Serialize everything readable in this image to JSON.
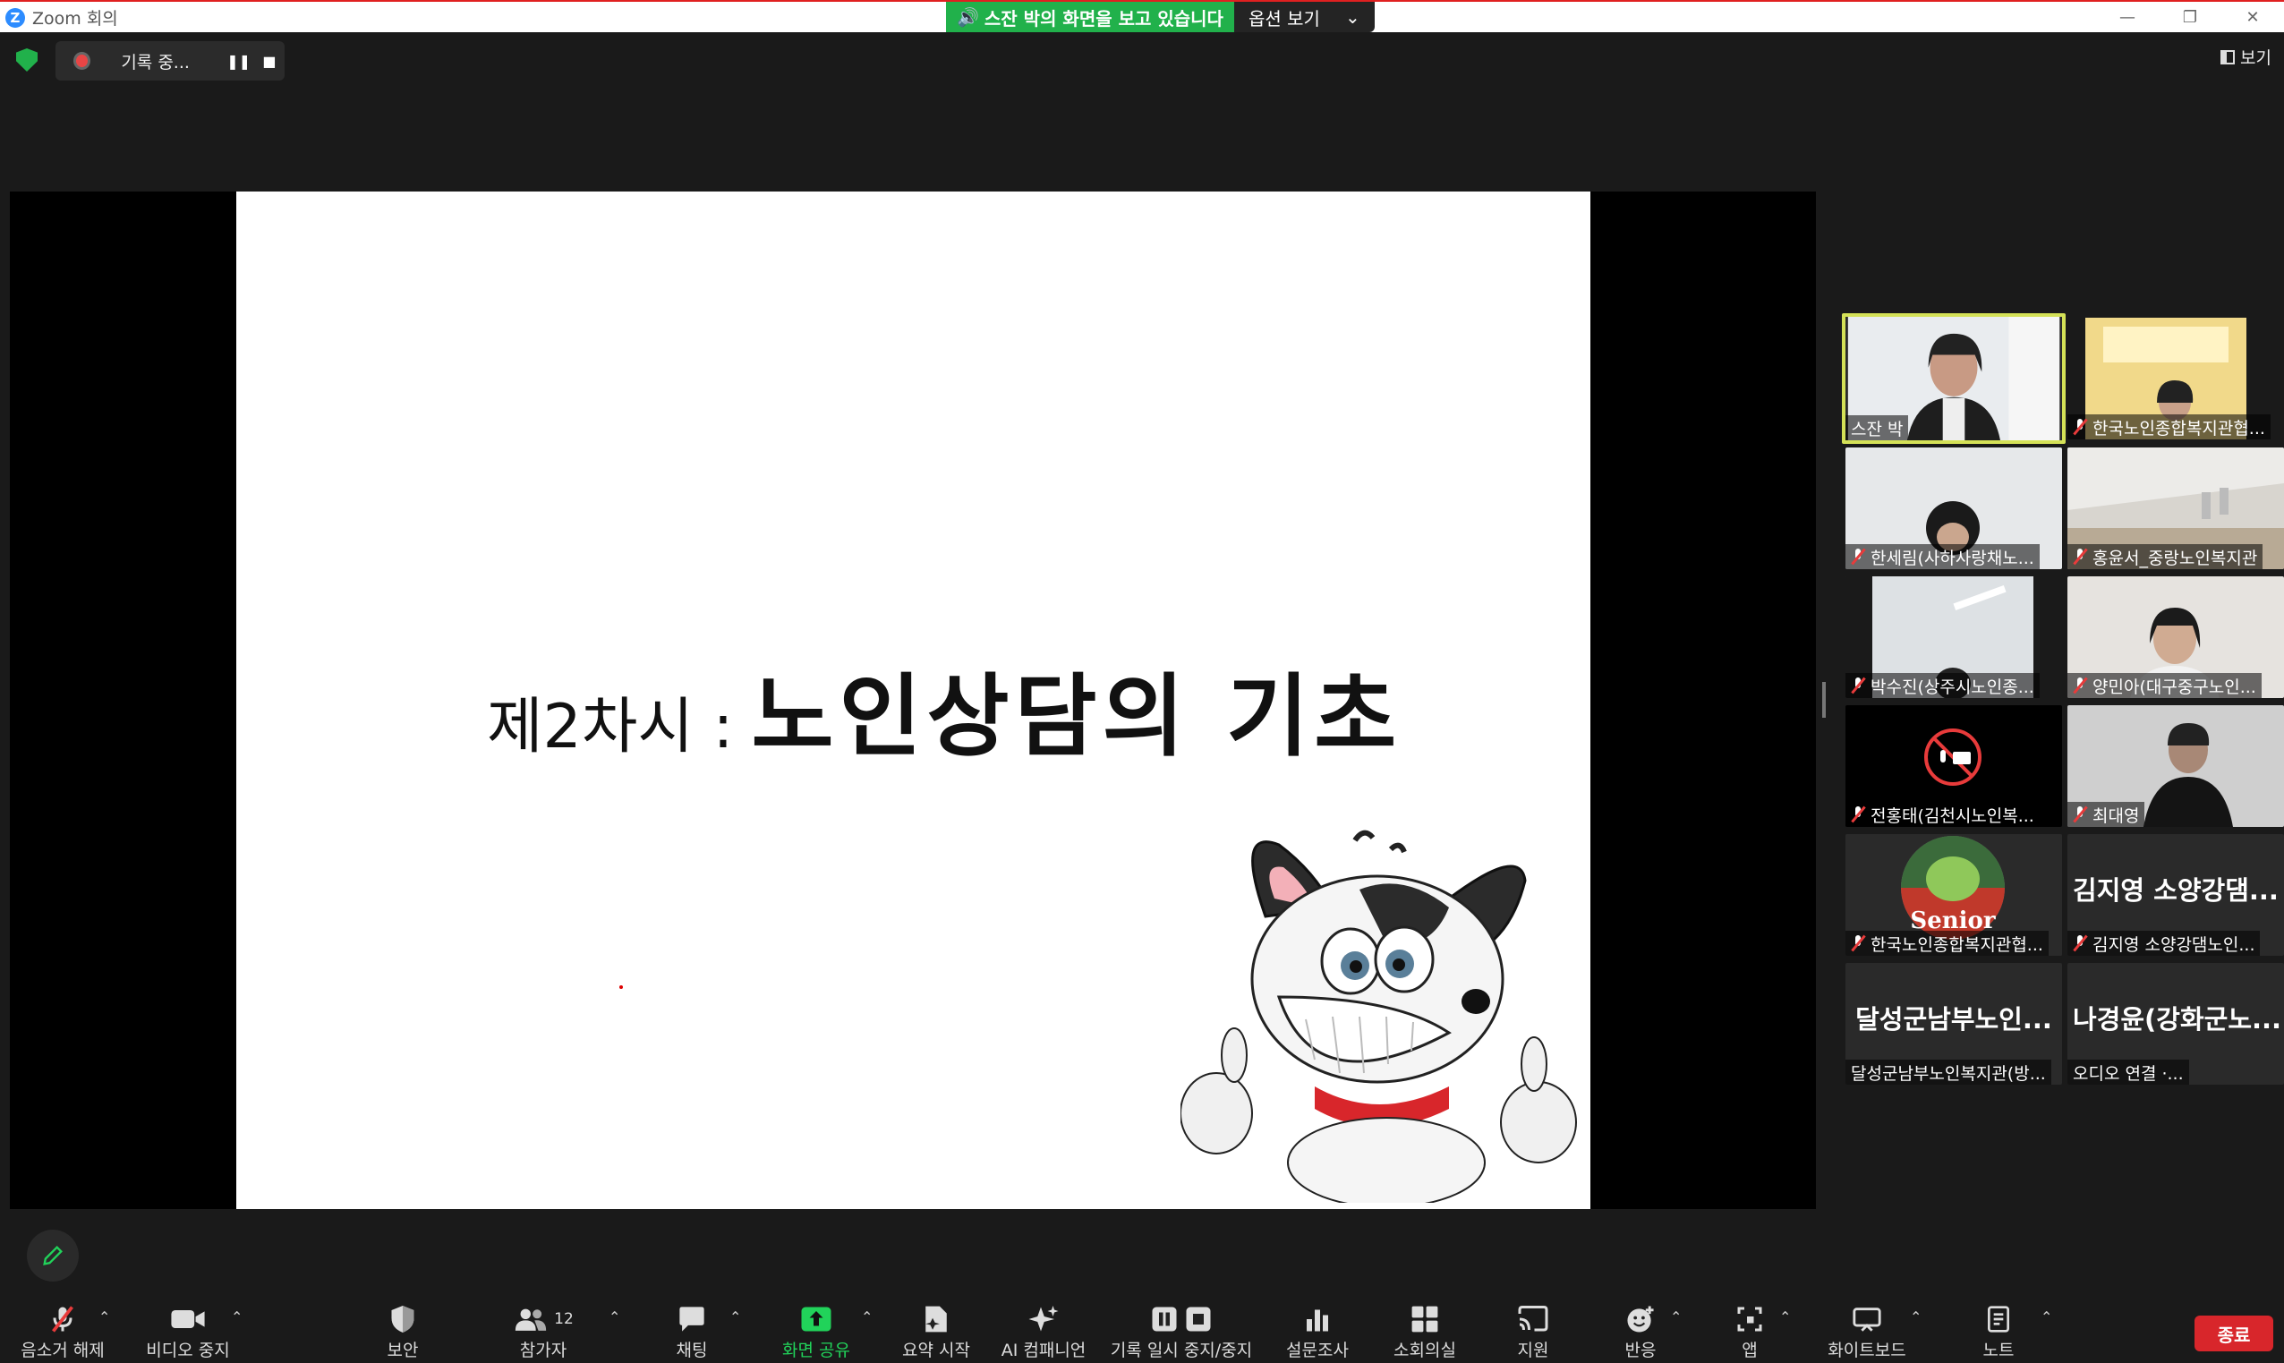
{
  "window": {
    "title": "Zoom 회의",
    "minimize": "—",
    "restore": "❐",
    "close": "✕"
  },
  "share_banner": {
    "viewing_text": "스잔 박의 화면을 보고 있습니다",
    "options_label": "옵션 보기"
  },
  "recording": {
    "status": "기록 중...",
    "pause": "❚❚",
    "stop": "■"
  },
  "view_button": "보기",
  "slide": {
    "prefix": "제2차시 :",
    "title": "노인상담의 기초"
  },
  "participants": [
    {
      "name": "스잔 박",
      "muted": false,
      "active": true
    },
    {
      "name": "한국노인종합복지관협...",
      "muted": true
    },
    {
      "name": "한세림(사하사랑채노...",
      "muted": true
    },
    {
      "name": "홍윤서_중랑노인복지관",
      "muted": true
    },
    {
      "name": "박수진(상주시노인종...",
      "muted": true
    },
    {
      "name": "양민아(대구중구노인...",
      "muted": true
    },
    {
      "name": "전홍태(김천시노인복...",
      "muted": true
    },
    {
      "name": "최대영",
      "muted": true
    },
    {
      "name": "한국노인종합복지관협...",
      "muted": true
    },
    {
      "name": "김지영 소양강댐노인...",
      "muted": true,
      "display": "김지영 소양강댐..."
    },
    {
      "name": "달성군남부노인복지관(방...",
      "muted": false,
      "display": "달성군남부노인..."
    },
    {
      "name": "오디오 연결 ·...",
      "muted": false,
      "display": "나경윤(강화군노..."
    }
  ],
  "senior_logo_text": "Senior",
  "toolbar": {
    "unmute": "음소거 해제",
    "stop_video": "비디오 중지",
    "security": "보안",
    "participants": "참가자",
    "participants_count": "12",
    "chat": "채팅",
    "share_screen": "화면 공유",
    "summary": "요약 시작",
    "ai_companion": "AI 컴패니언",
    "record_pause_stop": "기록 일시 중지/중지",
    "polls": "설문조사",
    "breakout": "소회의실",
    "support": "지원",
    "reactions": "반응",
    "apps": "앱",
    "whiteboard": "화이트보드",
    "notes": "노트",
    "end": "종료"
  },
  "colors": {
    "accent_green": "#21b14b",
    "end_red": "#d8262b",
    "active_border": "#d4e157",
    "mute_red": "#e83b3b"
  }
}
